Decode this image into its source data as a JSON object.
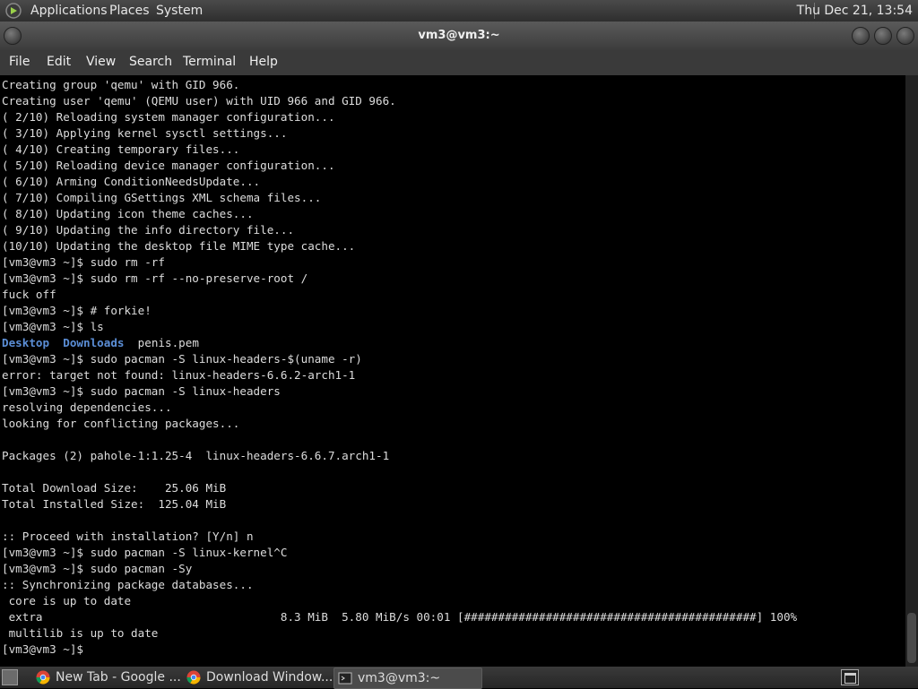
{
  "top_panel": {
    "menus": [
      "Applications",
      "Places",
      "System"
    ],
    "clock": "Thu Dec 21, 13:54"
  },
  "window": {
    "title": "vm3@vm3:~",
    "menu": [
      "File",
      "Edit",
      "View",
      "Search",
      "Terminal",
      "Help"
    ]
  },
  "terminal": {
    "lines": [
      "Creating group 'qemu' with GID 966.",
      "Creating user 'qemu' (QEMU user) with UID 966 and GID 966.",
      "( 2/10) Reloading system manager configuration...",
      "( 3/10) Applying kernel sysctl settings...",
      "( 4/10) Creating temporary files...",
      "( 5/10) Reloading device manager configuration...",
      "( 6/10) Arming ConditionNeedsUpdate...",
      "( 7/10) Compiling GSettings XML schema files...",
      "( 8/10) Updating icon theme caches...",
      "( 9/10) Updating the info directory file...",
      "(10/10) Updating the desktop file MIME type cache...",
      "[vm3@vm3 ~]$ sudo rm -rf",
      "[vm3@vm3 ~]$ sudo rm -rf --no-preserve-root /",
      "fuck off",
      "[vm3@vm3 ~]$ # forkie!",
      "[vm3@vm3 ~]$ ls",
      "LS_OUTPUT",
      "[vm3@vm3 ~]$ sudo pacman -S linux-headers-$(uname -r)",
      "error: target not found: linux-headers-6.6.2-arch1-1",
      "[vm3@vm3 ~]$ sudo pacman -S linux-headers",
      "resolving dependencies...",
      "looking for conflicting packages...",
      "",
      "Packages (2) pahole-1:1.25-4  linux-headers-6.6.7.arch1-1",
      "",
      "Total Download Size:    25.06 MiB",
      "Total Installed Size:  125.04 MiB",
      "",
      ":: Proceed with installation? [Y/n] n",
      "[vm3@vm3 ~]$ sudo pacman -S linux-kernel^C",
      "[vm3@vm3 ~]$ sudo pacman -Sy",
      ":: Synchronizing package databases...",
      " core is up to date",
      " extra                                   8.3 MiB  5.80 MiB/s 00:01 [###########################################] 100%",
      " multilib is up to date",
      "[vm3@vm3 ~]$ "
    ],
    "ls_output": {
      "dirs": [
        "Desktop",
        "Downloads"
      ],
      "file": "penis.pem"
    }
  },
  "taskbar": {
    "tasks": [
      {
        "label": "New Tab - Google ...",
        "icon": "chrome-icon"
      },
      {
        "label": "Download Window...",
        "icon": "chrome-icon"
      },
      {
        "label": "vm3@vm3:~",
        "icon": "terminal-icon",
        "active": true
      }
    ]
  },
  "colors": {
    "terminal_bg": "#000000",
    "terminal_fg": "#dddddd",
    "directory": "#5b8ed6",
    "panel": "#3a3a3a"
  }
}
